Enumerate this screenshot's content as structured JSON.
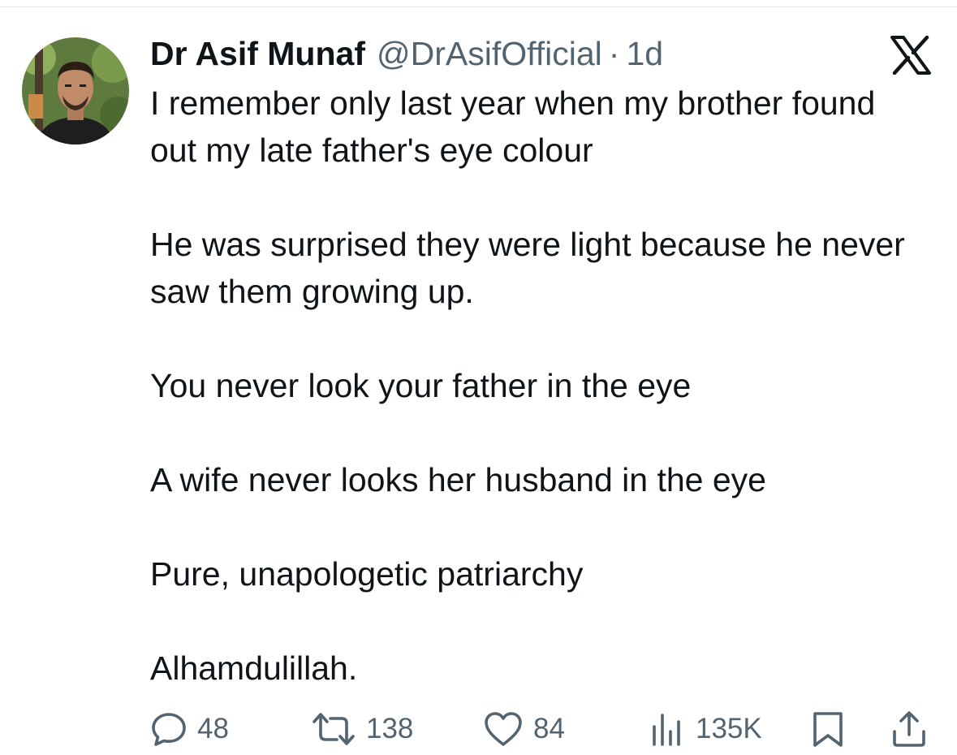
{
  "tweet": {
    "author": {
      "name": "Dr Asif Munaf",
      "handle": "@DrAsifOfficial",
      "separator": "·",
      "time": "1d",
      "avatar_icon": "profile-photo"
    },
    "platform_icon": "x-logo-icon",
    "paragraphs": [
      "I remember only last year when my brother found out my late father's eye colour",
      "He was surprised they were light because he never saw them growing up.",
      "You never look your father in the eye",
      "A wife never looks her husband in the eye",
      "Pure, unapologetic patriarchy",
      "Alhamdulillah."
    ],
    "actions": {
      "replies": "48",
      "retweets": "138",
      "likes": "84",
      "views": "135K"
    }
  },
  "colors": {
    "text": "#0f1419",
    "secondary": "#536471",
    "divider": "#e7e9ea",
    "background": "#ffffff"
  }
}
